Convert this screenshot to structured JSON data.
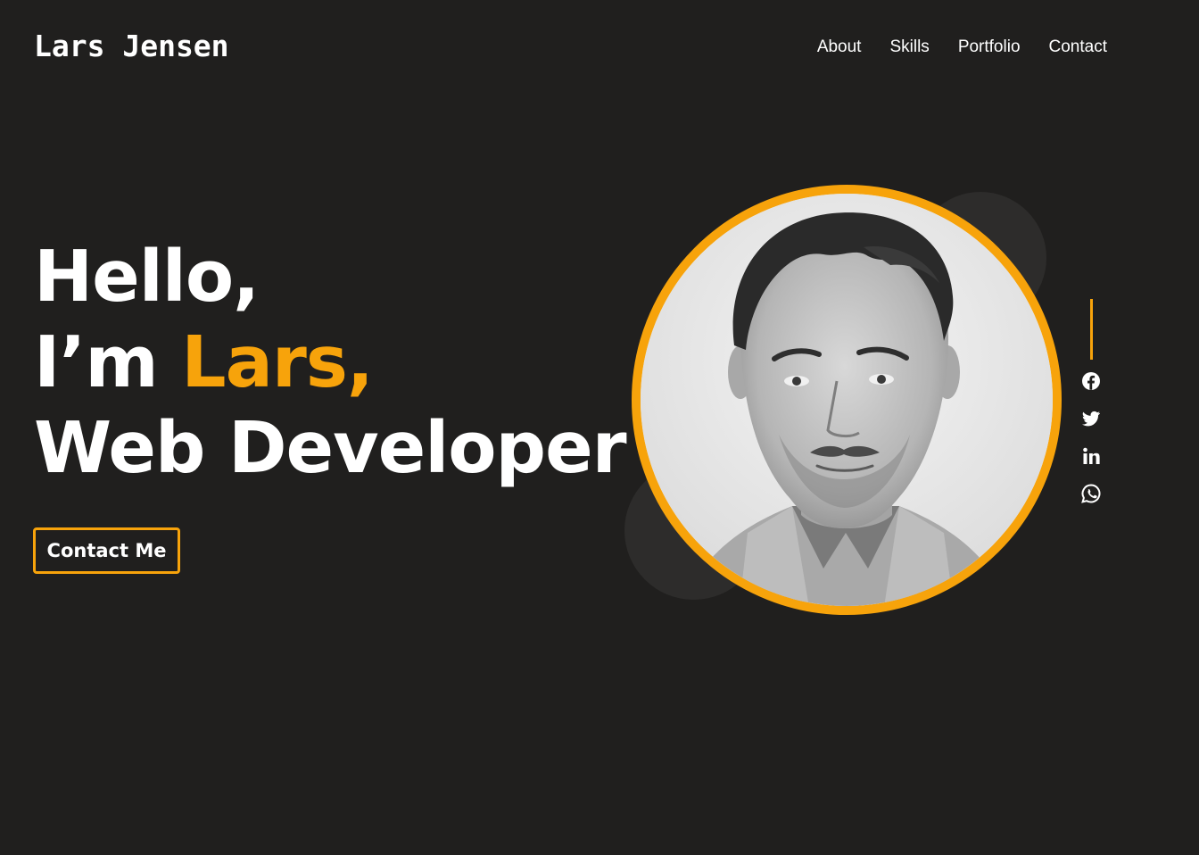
{
  "header": {
    "logo": "Lars Jensen",
    "nav": [
      {
        "label": "About"
      },
      {
        "label": "Skills"
      },
      {
        "label": "Portfolio"
      },
      {
        "label": "Contact"
      }
    ]
  },
  "hero": {
    "line1": "Hello,",
    "line2_prefix": "I’m ",
    "line2_name": "Lars,",
    "line3": "Web Developer",
    "cta_label": "Contact Me"
  },
  "photo": {
    "description_icon": "portrait-photo"
  },
  "social": {
    "icons": [
      "facebook-icon",
      "twitter-icon",
      "linkedin-icon",
      "whatsapp-icon"
    ]
  },
  "colors": {
    "background": "#201f1e",
    "accent": "#f7a30b",
    "text": "#ffffff",
    "decor_circle": "#2d2c2b"
  }
}
